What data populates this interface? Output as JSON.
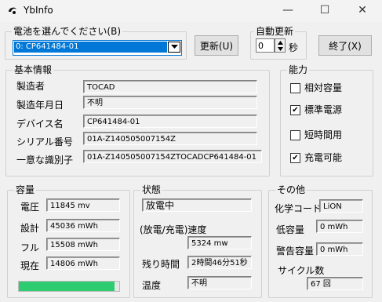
{
  "window": {
    "title": "YbInfo"
  },
  "battery_select": {
    "label": "電池を選んでください(B)",
    "value": "0: CP641484-01",
    "update_button": "更新(U)"
  },
  "auto_update": {
    "label": "自動更新",
    "value": "0",
    "unit": "秒"
  },
  "exit_button": "終了(X)",
  "basic": {
    "title": "基本情報",
    "fields": [
      {
        "label": "製造者",
        "value": "TOCAD"
      },
      {
        "label": "製造年月日",
        "value": "不明"
      },
      {
        "label": "デバイス名",
        "value": "CP641484-01"
      },
      {
        "label": "シリアル番号",
        "value": "01A-Z140505007154Z"
      },
      {
        "label": "一意な識別子",
        "value": "01A-Z140505007154ZTOCADCP641484-01"
      }
    ]
  },
  "capability": {
    "title": "能力",
    "items": [
      {
        "label": "相対容量",
        "checked": false
      },
      {
        "label": "標準電源",
        "checked": true
      },
      {
        "label": "短時間用",
        "checked": false
      },
      {
        "label": "充電可能",
        "checked": true
      }
    ]
  },
  "capacity": {
    "title": "容量",
    "fields": [
      {
        "label": "電圧",
        "value": "11845 mv"
      },
      {
        "label": "設計",
        "value": "45036 mWh"
      },
      {
        "label": "フル",
        "value": "15508 mWh"
      },
      {
        "label": "現在",
        "value": "14806 mWh"
      }
    ],
    "charge_fraction": 0.95
  },
  "state": {
    "title": "状態",
    "status": "放電中",
    "rate_label": "(放電/充電)速度",
    "rate_value": "5324 mw",
    "remaining_label": "残り時間",
    "remaining_value": "2時間46分51秒",
    "temp_label": "温度",
    "temp_value": "不明"
  },
  "other": {
    "title": "その他",
    "chem_label": "化学コード",
    "chem_value": "LiON",
    "low_label": "低容量",
    "low_value": "0 mWh",
    "warn_label": "警告容量",
    "warn_value": "0 mWh",
    "cycle_label": "サイクル数",
    "cycle_value": "67 回"
  },
  "colors": {
    "progress": "#2ecc71",
    "selection": "#0078d7"
  }
}
